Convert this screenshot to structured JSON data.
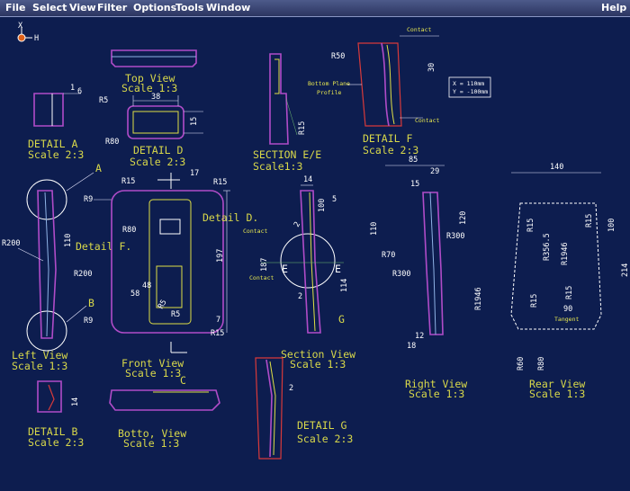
{
  "menu": {
    "file": "File",
    "select": "Select",
    "view": "View",
    "filter": "Filter",
    "options": "Options",
    "tools": "Tools",
    "window": "Window",
    "help": "Help"
  },
  "axis": {
    "x": "X",
    "y": "H"
  },
  "coords": {
    "x": "X = 110mm",
    "y": "Y = -100mm"
  },
  "views": {
    "top_view": "Top View",
    "top_view_scale": "Scale 1:3",
    "detail_a": "DETAIL A",
    "detail_a_scale": "Scale 2:3",
    "detail_d": "DETAIL D",
    "detail_d_scale": "Scale 2:3",
    "section_ee": "SECTION E/E",
    "section_ee_scale": "Scale1:3",
    "detail_f": "DETAIL F",
    "detail_f_scale": "Scale 2:3",
    "left_view": "Left View",
    "left_view_scale": "Scale 1:3",
    "front_view": "Front View",
    "front_view_scale": "Scale 1:3",
    "section_view": "Section View",
    "section_view_scale": "Scale 1:3",
    "right_view": "Right View",
    "right_view_scale": "Scale 1:3",
    "rear_view": "Rear View",
    "rear_view_scale": "Scale 1:3",
    "detail_b": "DETAIL B",
    "detail_b_scale": "Scale 2:3",
    "bottom_view": "Botto, View",
    "bottom_view_scale": "Scale 1:3",
    "detail_g": "DETAIL G",
    "detail_g_scale": "Scale 2:3"
  },
  "callouts": {
    "a": "A",
    "b": "B",
    "c": "C",
    "detail_d_ref": "Detail D.",
    "detail_f_ref": "Detail F.",
    "contact": "Contact",
    "bottom_plane": "Bottom Plane",
    "profile": "Profile",
    "tangent": "Tangent",
    "sec_e": "E",
    "sec_g": "G"
  },
  "dims": {
    "r5": "R5",
    "r80": "R80",
    "d38": "38",
    "d15": "15",
    "d6": "6",
    "d1": "1",
    "r50": "R50",
    "d30": "30",
    "r15": "R15",
    "d17": "17",
    "r9": "R9",
    "r200": "R200",
    "d110": "110",
    "d197": "197",
    "d48": "48",
    "d58": "58",
    "d7": "7",
    "d2": "2",
    "d14": "14",
    "d100": "100",
    "d187": "187",
    "d114": "114",
    "d5": "5",
    "d85": "85",
    "d29": "29",
    "d120": "120",
    "r300": "R300",
    "r70": "R70",
    "d12": "12",
    "d18": "18",
    "d140": "140",
    "r356": "R356.5",
    "r1946": "R1946",
    "d90": "90",
    "d214": "214",
    "r60": "R60"
  }
}
